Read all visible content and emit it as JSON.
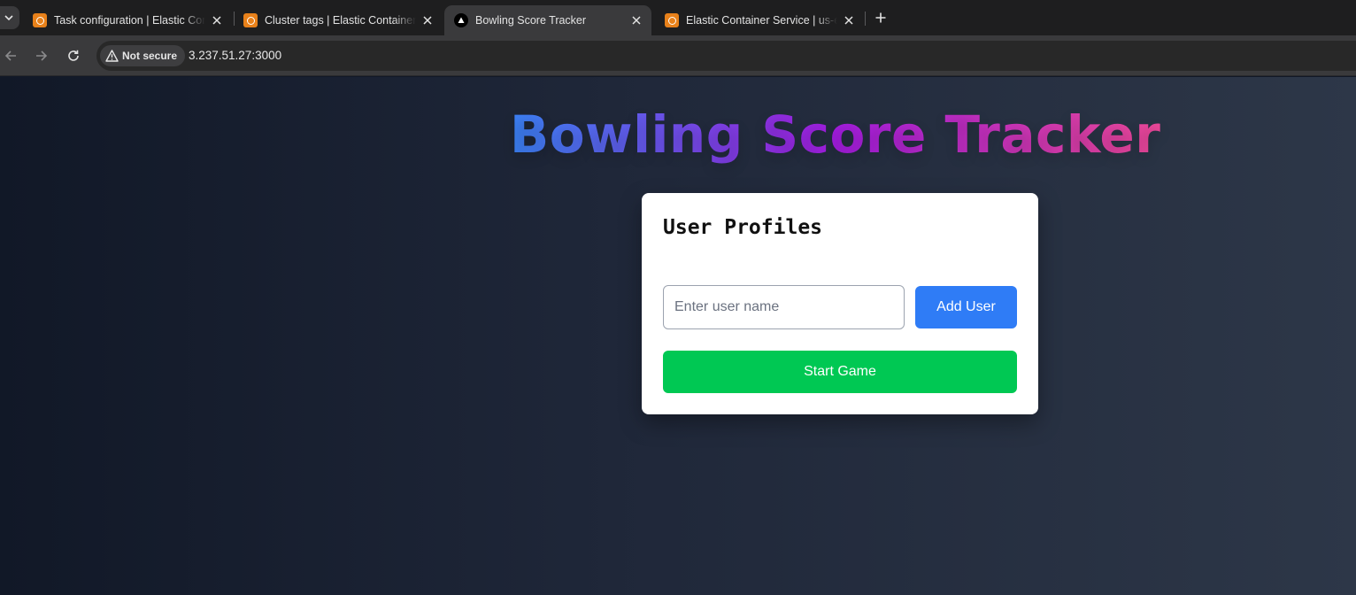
{
  "browser": {
    "tabs": [
      {
        "title": "Task configuration | Elastic Cont",
        "icon": "aws-ecs-icon",
        "active": false
      },
      {
        "title": "Cluster tags | Elastic Container S",
        "icon": "aws-ecs-icon",
        "active": false
      },
      {
        "title": "Bowling Score Tracker",
        "icon": "nextjs-icon",
        "active": true
      },
      {
        "title": "Elastic Container Service | us-ea",
        "icon": "aws-ecs-icon",
        "active": false
      }
    ],
    "security_label": "Not secure",
    "url": "3.237.51.27:3000"
  },
  "page": {
    "title": "Bowling Score Tracker",
    "card": {
      "heading": "User Profiles",
      "input_placeholder": "Enter user name",
      "input_value": "",
      "add_button_label": "Add User",
      "start_button_label": "Start Game"
    }
  },
  "colors": {
    "title_gradient": [
      "#3b82f6",
      "#a21cde",
      "#ec4899"
    ],
    "add_button": "#2f7cf6",
    "start_button": "#00c853",
    "background_gradient": [
      "#111827",
      "#2d3748"
    ]
  }
}
